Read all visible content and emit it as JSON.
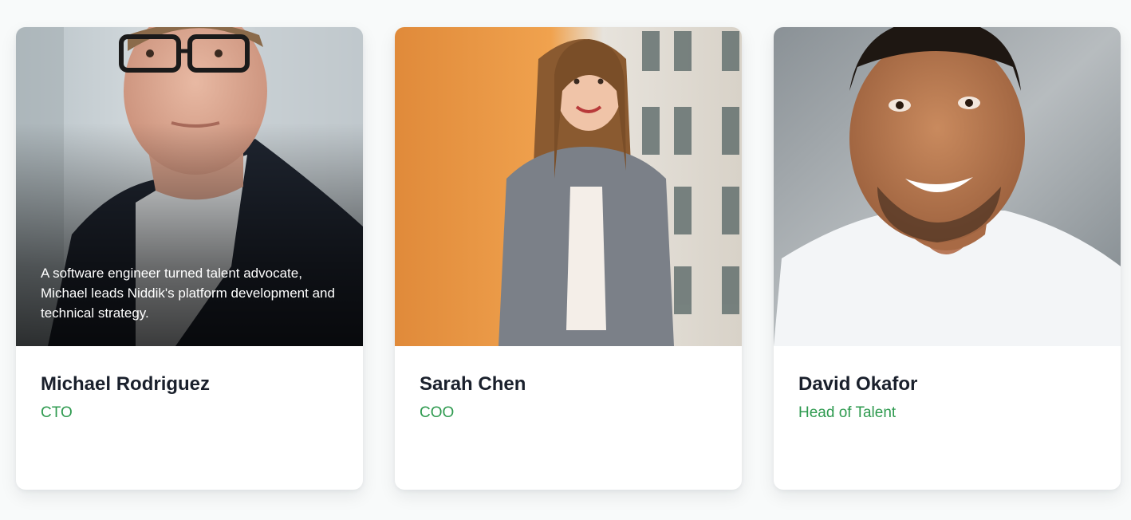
{
  "team": [
    {
      "name": "Michael Rodriguez",
      "role": "CTO",
      "bio": "A software engineer turned talent advocate, Michael leads Niddik's platform development and technical strategy."
    },
    {
      "name": "Sarah Chen",
      "role": "COO"
    },
    {
      "name": "David Okafor",
      "role": "Head of Talent"
    }
  ],
  "colors": {
    "role_accent": "#2e9a4f",
    "name_text": "#1a202c",
    "page_background": "#f8fafa"
  }
}
